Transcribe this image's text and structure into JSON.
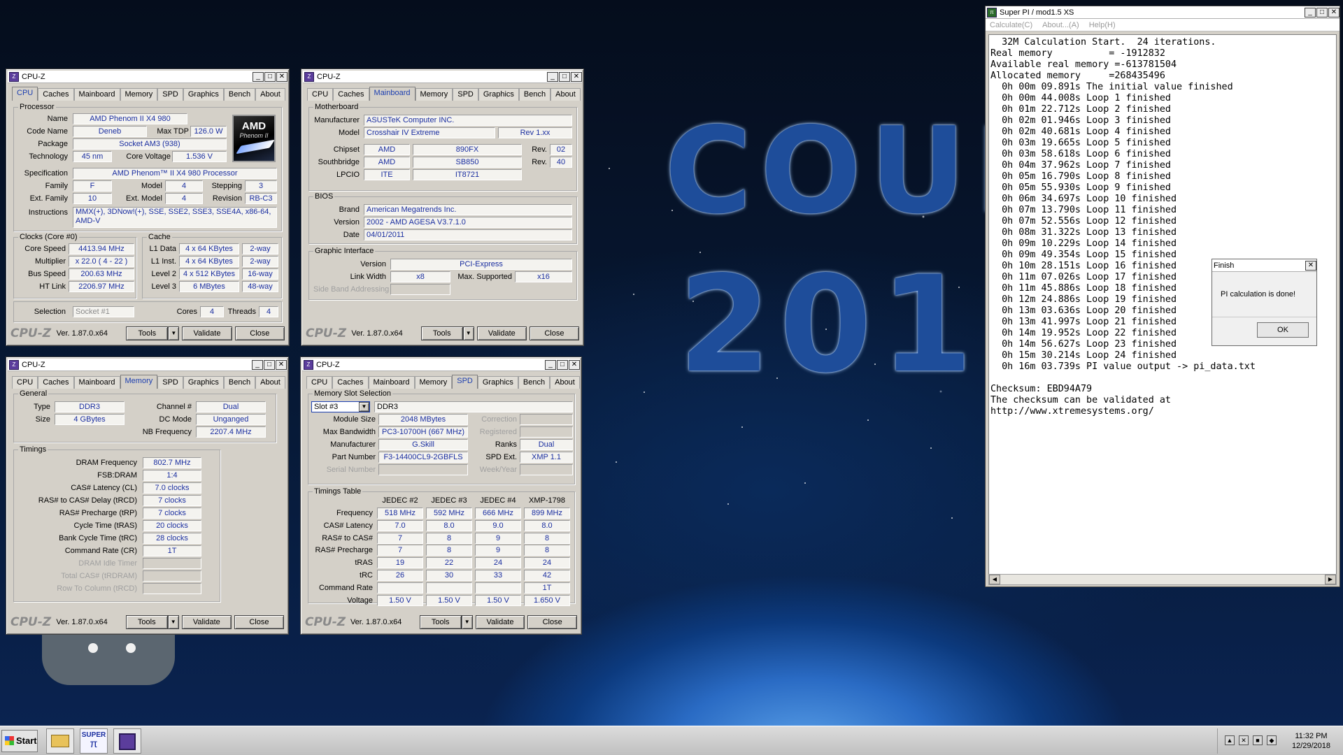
{
  "wallpaper": {
    "line1": "COUN",
    "line2": "2018"
  },
  "cpuz_cpu": {
    "title": "CPU-Z",
    "tabs": [
      "CPU",
      "Caches",
      "Mainboard",
      "Memory",
      "SPD",
      "Graphics",
      "Bench",
      "About"
    ],
    "active_tab": "CPU",
    "processor_group": "Processor",
    "labels": {
      "name": "Name",
      "code_name": "Code Name",
      "max_tdp": "Max TDP",
      "package": "Package",
      "technology": "Technology",
      "core_voltage": "Core Voltage",
      "specification": "Specification",
      "family": "Family",
      "model": "Model",
      "stepping": "Stepping",
      "ext_family": "Ext. Family",
      "ext_model": "Ext. Model",
      "revision": "Revision",
      "instructions": "Instructions"
    },
    "name": "AMD Phenom II X4 980",
    "code_name": "Deneb",
    "max_tdp": "126.0 W",
    "package": "Socket AM3 (938)",
    "technology": "45 nm",
    "core_voltage": "1.536 V",
    "specification": "AMD Phenom™ II X4 980 Processor",
    "family": "F",
    "model": "4",
    "stepping": "3",
    "ext_family": "10",
    "ext_model": "4",
    "revision": "RB-C3",
    "instructions": "MMX(+), 3DNow!(+), SSE, SSE2, SSE3, SSE4A, x86-64, AMD-V",
    "logo": {
      "brand": "AMD",
      "sub": "Phenom II"
    },
    "clocks_group": "Clocks (Core #0)",
    "clock_labels": {
      "core_speed": "Core Speed",
      "multiplier": "Multiplier",
      "bus_speed": "Bus Speed",
      "ht_link": "HT Link"
    },
    "core_speed": "4413.94 MHz",
    "multiplier": "x 22.0 ( 4 - 22 )",
    "bus_speed": "200.63 MHz",
    "ht_link": "2206.97 MHz",
    "cache_group": "Cache",
    "cache_labels": {
      "l1d": "L1 Data",
      "l1i": "L1 Inst.",
      "l2": "Level 2",
      "l3": "Level 3"
    },
    "l1d": "4 x 64 KBytes",
    "l1d_way": "2-way",
    "l1i": "4 x 64 KBytes",
    "l1i_way": "2-way",
    "l2": "4 x 512 KBytes",
    "l2_way": "16-way",
    "l3": "6 MBytes",
    "l3_way": "48-way",
    "selection_label": "Selection",
    "selection_value": "Socket #1",
    "cores_label": "Cores",
    "cores": "4",
    "threads_label": "Threads",
    "threads": "4"
  },
  "cpuz_mainboard": {
    "title": "CPU-Z",
    "active_tab": "Mainboard",
    "motherboard_group": "Motherboard",
    "labels": {
      "manufacturer": "Manufacturer",
      "model": "Model",
      "chipset": "Chipset",
      "southbridge": "Southbridge",
      "lpcio": "LPCIO",
      "rev": "Rev."
    },
    "manufacturer": "ASUSTeK Computer INC.",
    "model": "Crosshair IV Extreme",
    "model_rev": "Rev 1.xx",
    "chipset_vendor": "AMD",
    "chipset": "890FX",
    "chipset_rev": "02",
    "southbridge_vendor": "AMD",
    "southbridge": "SB850",
    "southbridge_rev": "40",
    "lpcio_vendor": "ITE",
    "lpcio": "IT8721",
    "bios_group": "BIOS",
    "bios_labels": {
      "brand": "Brand",
      "version": "Version",
      "date": "Date"
    },
    "bios_brand": "American Megatrends Inc.",
    "bios_version": "2002 - AMD AGESA V3.7.1.0",
    "bios_date": "04/01/2011",
    "graphic_group": "Graphic Interface",
    "graphic_labels": {
      "version": "Version",
      "link_width": "Link Width",
      "max_supported": "Max. Supported",
      "side_band": "Side Band Addressing"
    },
    "gi_version": "PCI-Express",
    "gi_link_width": "x8",
    "gi_max_supported": "x16"
  },
  "cpuz_memory": {
    "title": "CPU-Z",
    "active_tab": "Memory",
    "general_group": "General",
    "labels": {
      "type": "Type",
      "size": "Size",
      "channel": "Channel #",
      "dc_mode": "DC Mode",
      "nb_freq": "NB Frequency"
    },
    "type": "DDR3",
    "size": "4 GBytes",
    "channel": "Dual",
    "dc_mode": "Unganged",
    "nb_freq": "2207.4 MHz",
    "timings_group": "Timings",
    "timings": [
      {
        "label": "DRAM Frequency",
        "value": "802.7 MHz"
      },
      {
        "label": "FSB:DRAM",
        "value": "1:4"
      },
      {
        "label": "CAS# Latency (CL)",
        "value": "7.0 clocks"
      },
      {
        "label": "RAS# to CAS# Delay (tRCD)",
        "value": "7 clocks"
      },
      {
        "label": "RAS# Precharge (tRP)",
        "value": "7 clocks"
      },
      {
        "label": "Cycle Time (tRAS)",
        "value": "20 clocks"
      },
      {
        "label": "Bank Cycle Time (tRC)",
        "value": "28 clocks"
      },
      {
        "label": "Command Rate (CR)",
        "value": "1T"
      },
      {
        "label": "DRAM Idle Timer",
        "value": ""
      },
      {
        "label": "Total CAS# (tRDRAM)",
        "value": ""
      },
      {
        "label": "Row To Column (tRCD)",
        "value": ""
      }
    ]
  },
  "cpuz_spd": {
    "title": "CPU-Z",
    "active_tab": "SPD",
    "slot_group": "Memory Slot Selection",
    "slot": "Slot #3",
    "slot_type": "DDR3",
    "labels": {
      "module_size": "Module Size",
      "max_bandwidth": "Max Bandwidth",
      "manufacturer": "Manufacturer",
      "part_number": "Part Number",
      "serial_number": "Serial Number",
      "correction": "Correction",
      "registered": "Registered",
      "ranks": "Ranks",
      "spd_ext": "SPD Ext.",
      "week_year": "Week/Year"
    },
    "module_size": "2048 MBytes",
    "max_bandwidth": "PC3-10700H (667 MHz)",
    "manufacturer": "G.Skill",
    "part_number": "F3-14400CL9-2GBFLS",
    "ranks": "Dual",
    "spd_ext": "XMP 1.1",
    "timings_group": "Timings Table",
    "columns": [
      "JEDEC #2",
      "JEDEC #3",
      "JEDEC #4",
      "XMP-1798"
    ],
    "rows": [
      {
        "label": "Frequency",
        "values": [
          "518 MHz",
          "592 MHz",
          "666 MHz",
          "899 MHz"
        ]
      },
      {
        "label": "CAS# Latency",
        "values": [
          "7.0",
          "8.0",
          "9.0",
          "8.0"
        ]
      },
      {
        "label": "RAS# to CAS#",
        "values": [
          "7",
          "8",
          "9",
          "8"
        ]
      },
      {
        "label": "RAS# Precharge",
        "values": [
          "7",
          "8",
          "9",
          "8"
        ]
      },
      {
        "label": "tRAS",
        "values": [
          "19",
          "22",
          "24",
          "24"
        ]
      },
      {
        "label": "tRC",
        "values": [
          "26",
          "30",
          "33",
          "42"
        ]
      },
      {
        "label": "Command Rate",
        "values": [
          "",
          "",
          "",
          "1T"
        ]
      },
      {
        "label": "Voltage",
        "values": [
          "1.50 V",
          "1.50 V",
          "1.50 V",
          "1.650 V"
        ]
      }
    ]
  },
  "cpuz_footer": {
    "brand": "CPU-Z",
    "version": "Ver. 1.87.0.x64",
    "tools": "Tools",
    "validate": "Validate",
    "close": "Close"
  },
  "superpi": {
    "title": "Super PI / mod1.5 XS",
    "menu": [
      "Calculate(C)",
      "About...(A)",
      "Help(H)"
    ],
    "lines": [
      "  32M Calculation Start.  24 iterations.",
      "Real memory          = -1912832",
      "Available real memory =-613781504",
      "Allocated memory     =268435496",
      "  0h 00m 09.891s The initial value finished",
      "  0h 00m 44.008s Loop 1 finished",
      "  0h 01m 22.712s Loop 2 finished",
      "  0h 02m 01.946s Loop 3 finished",
      "  0h 02m 40.681s Loop 4 finished",
      "  0h 03m 19.665s Loop 5 finished",
      "  0h 03m 58.618s Loop 6 finished",
      "  0h 04m 37.962s Loop 7 finished",
      "  0h 05m 16.790s Loop 8 finished",
      "  0h 05m 55.930s Loop 9 finished",
      "  0h 06m 34.697s Loop 10 finished",
      "  0h 07m 13.790s Loop 11 finished",
      "  0h 07m 52.556s Loop 12 finished",
      "  0h 08m 31.322s Loop 13 finished",
      "  0h 09m 10.229s Loop 14 finished",
      "  0h 09m 49.354s Loop 15 finished",
      "  0h 10m 28.151s Loop 16 finished",
      "  0h 11m 07.026s Loop 17 finished",
      "  0h 11m 45.886s Loop 18 finished",
      "  0h 12m 24.886s Loop 19 finished",
      "  0h 13m 03.636s Loop 20 finished",
      "  0h 13m 41.997s Loop 21 finished",
      "  0h 14m 19.952s Loop 22 finished",
      "  0h 14m 56.627s Loop 23 finished",
      "  0h 15m 30.214s Loop 24 finished",
      "  0h 16m 03.739s PI value output -> pi_data.txt",
      "",
      "Checksum: EBD94A79",
      "The checksum can be validated at",
      "http://www.xtremesystems.org/"
    ]
  },
  "finish_dialog": {
    "title": "Finish",
    "message": "PI calculation is done!",
    "ok": "OK"
  },
  "taskbar": {
    "start": "Start",
    "superpi_icon_text": "SUPER",
    "clock_time": "11:32 PM",
    "clock_date": "12/29/2018"
  }
}
